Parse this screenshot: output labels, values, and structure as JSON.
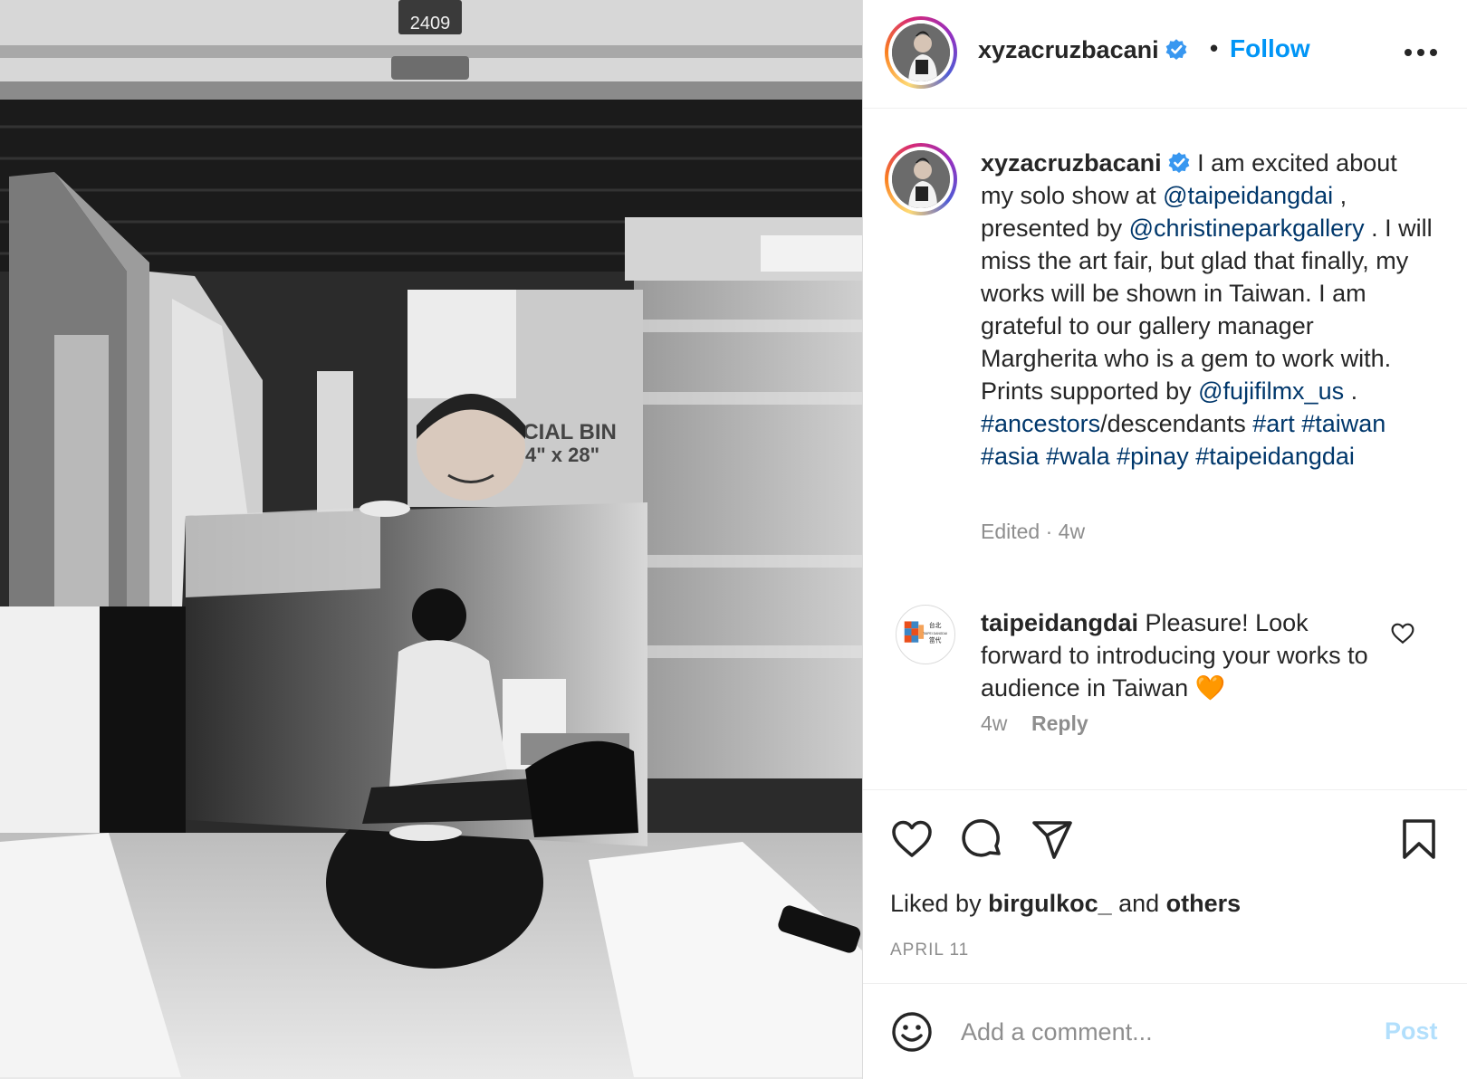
{
  "photo": {
    "unit_number": "2409",
    "box_label_line1": "RCIAL BIN",
    "box_label_line2": "4\" x 28\"",
    "alt_icon": "photo-content"
  },
  "header": {
    "username": "xyzacruzbacani",
    "separator": "•",
    "follow_label": "Follow",
    "more_icon": "more-horizontal-icon"
  },
  "caption": {
    "username": "xyzacruzbacani",
    "seg1": " I am excited about my solo show at ",
    "mention1": "@taipeidangdai",
    "seg2": " , presented by ",
    "mention2": "@christineparkgallery",
    "seg3": " . I will miss the art fair, but glad that finally, my works will be shown in Taiwan. I am grateful to our gallery manager Margherita who is a gem to work with. Prints supported by ",
    "mention3": "@fujifilmx_us",
    "seg4": " . ",
    "hashtag1": "#ancestors",
    "seg5": "/descendants ",
    "hashtag2": "#art",
    "hashtag3": "#taiwan",
    "hashtag4": "#asia",
    "hashtag5": "#wala",
    "hashtag6": "#pinay",
    "hashtag7": "#taipeidangdai",
    "meta": "Edited · 4w"
  },
  "comment": {
    "username": "taipeidangdai",
    "text": " Pleasure! Look forward to introducing your works to audience in Taiwan ",
    "emoji": "🧡",
    "time": "4w",
    "reply_label": "Reply",
    "avatar_text_top": "台北",
    "avatar_text_mid": "TAIPEI DANGDAI",
    "avatar_text_bottom": "當代"
  },
  "actions": {
    "like_icon": "heart-icon",
    "comment_icon": "comment-icon",
    "share_icon": "send-icon",
    "save_icon": "bookmark-icon",
    "liked_prefix": "Liked by ",
    "liked_user": "birgulkoc_",
    "liked_mid": " and ",
    "liked_others": "others",
    "date": "APRIL 11"
  },
  "add_comment": {
    "placeholder": "Add a comment...",
    "post_label": "Post",
    "emoji_icon": "smiley-icon"
  },
  "colors": {
    "link": "#00376b",
    "follow": "#0095f6",
    "verified": "#3897f0",
    "post_disabled": "#b2dffc",
    "muted": "#8e8e8e"
  }
}
